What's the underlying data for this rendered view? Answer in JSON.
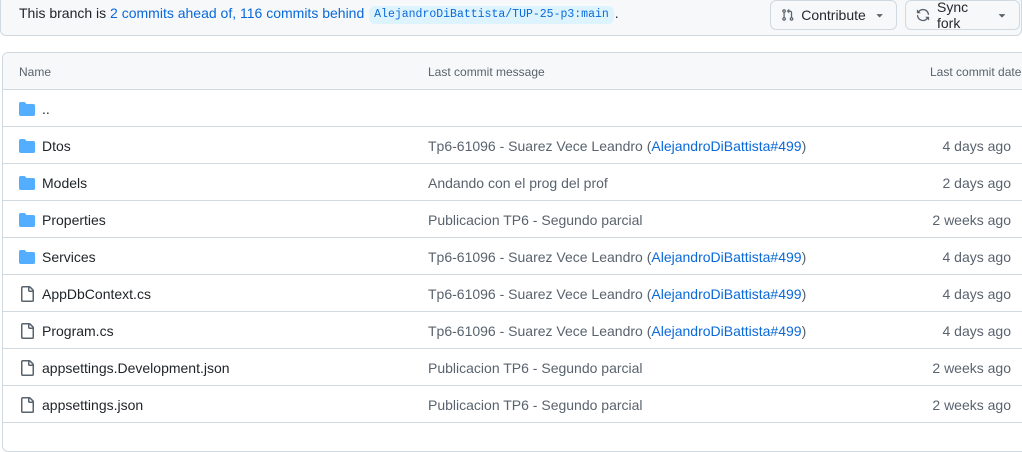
{
  "branch": {
    "prefix": "This branch is ",
    "ahead": "2 commits ahead of,",
    "behind": "116 commits behind",
    "ref": "AlejandroDiBattista/TUP-25-p3:main",
    "suffix": "."
  },
  "buttons": {
    "contribute": "Contribute",
    "sync": "Sync fork"
  },
  "table": {
    "headers": {
      "name": "Name",
      "message": "Last commit message",
      "date": "Last commit date"
    },
    "rows": [
      {
        "name": "..",
        "type": "folder",
        "message": "",
        "ref": "",
        "date": ""
      },
      {
        "name": "Dtos",
        "type": "folder",
        "message": "Tp6-61096 - Suarez Vece Leandro (",
        "ref": "AlejandroDiBattista#499",
        "close": ")",
        "date": "4 days ago"
      },
      {
        "name": "Models",
        "type": "folder",
        "message": "Andando con el prog del prof",
        "ref": "",
        "close": "",
        "date": "2 days ago"
      },
      {
        "name": "Properties",
        "type": "folder",
        "message": "Publicacion TP6 - Segundo parcial",
        "ref": "",
        "close": "",
        "date": "2 weeks ago"
      },
      {
        "name": "Services",
        "type": "folder",
        "message": "Tp6-61096 - Suarez Vece Leandro (",
        "ref": "AlejandroDiBattista#499",
        "close": ")",
        "date": "4 days ago"
      },
      {
        "name": "AppDbContext.cs",
        "type": "file",
        "message": "Tp6-61096 - Suarez Vece Leandro (",
        "ref": "AlejandroDiBattista#499",
        "close": ")",
        "date": "4 days ago"
      },
      {
        "name": "Program.cs",
        "type": "file",
        "message": "Tp6-61096 - Suarez Vece Leandro (",
        "ref": "AlejandroDiBattista#499",
        "close": ")",
        "date": "4 days ago"
      },
      {
        "name": "appsettings.Development.json",
        "type": "file",
        "message": "Publicacion TP6 - Segundo parcial",
        "ref": "",
        "close": "",
        "date": "2 weeks ago"
      },
      {
        "name": "appsettings.json",
        "type": "file",
        "message": "Publicacion TP6 - Segundo parcial",
        "ref": "",
        "close": "",
        "date": "2 weeks ago"
      }
    ]
  },
  "colors": {
    "folder": "#54aeff",
    "link": "#0969da",
    "muted": "#59636e",
    "border": "#d1d9e0"
  },
  "icons": {
    "folder": "folder-icon",
    "file": "file-icon",
    "contribute": "pull-request-icon",
    "sync": "sync-icon",
    "caret": "triangle-down-icon"
  }
}
